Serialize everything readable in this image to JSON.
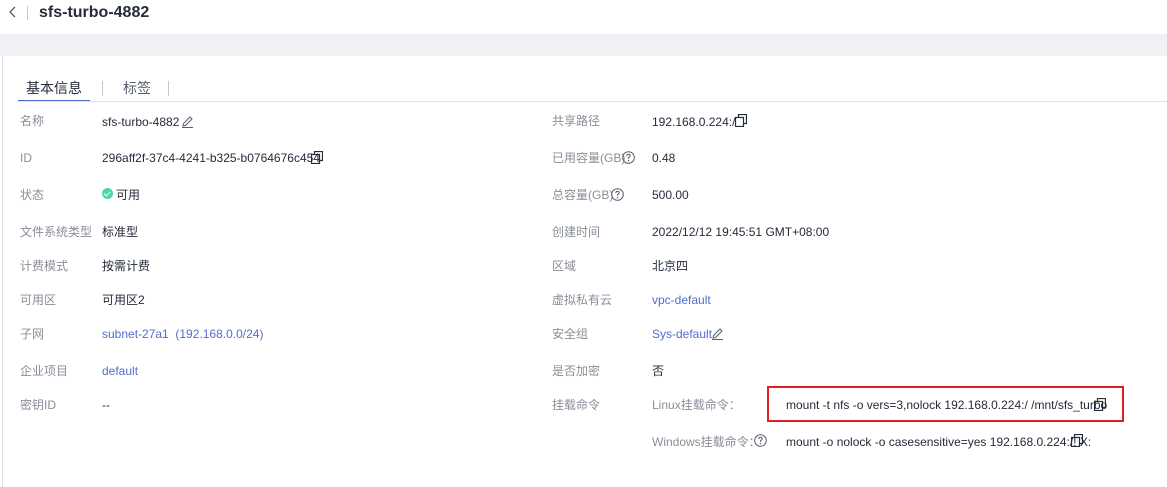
{
  "header": {
    "title": "sfs-turbo-4882"
  },
  "tabs": [
    {
      "label": "基本信息"
    },
    {
      "label": "标签"
    }
  ],
  "left": {
    "name_label": "名称",
    "name_value": "sfs-turbo-4882",
    "id_label": "ID",
    "id_value": "296aff2f-37c4-4241-b325-b0764676c454",
    "status_label": "状态",
    "status_value": "可用",
    "fs_type_label": "文件系统类型",
    "fs_type_value": "标准型",
    "billing_label": "计费模式",
    "billing_value": "按需计费",
    "az_label": "可用区",
    "az_value": "可用区2",
    "subnet_label": "子网",
    "subnet_value": "subnet-27a1  (192.168.0.0/24)",
    "project_label": "企业项目",
    "project_value": "default",
    "key_label": "密钥ID",
    "key_value": "--"
  },
  "right": {
    "path_label": "共享路径",
    "path_value": "192.168.0.224:/",
    "used_label": "已用容量(GB)",
    "used_value": "0.48",
    "total_label": "总容量(GB)",
    "total_value": "500.00",
    "created_label": "创建时间",
    "created_value": "2022/12/12 19:45:51 GMT+08:00",
    "region_label": "区域",
    "region_value": "北京四",
    "vpc_label": "虚拟私有云",
    "vpc_value": "vpc-default",
    "sg_label": "安全组",
    "sg_value": "Sys-default",
    "encrypt_label": "是否加密",
    "encrypt_value": "否",
    "mount_label": "挂载命令",
    "linux_label": "Linux挂载命令：",
    "linux_value": "mount -t nfs -o vers=3,nolock 192.168.0.224:/ /mnt/sfs_turbo",
    "windows_label": "Windows挂载命令：",
    "windows_value": "mount -o nolock -o casesensitive=yes 192.168.0.224:/! X:"
  },
  "colors": {
    "accent": "#526ecc",
    "status_ok": "#50d4ab",
    "highlight": "#e02020",
    "band": "#f0f1f5"
  }
}
